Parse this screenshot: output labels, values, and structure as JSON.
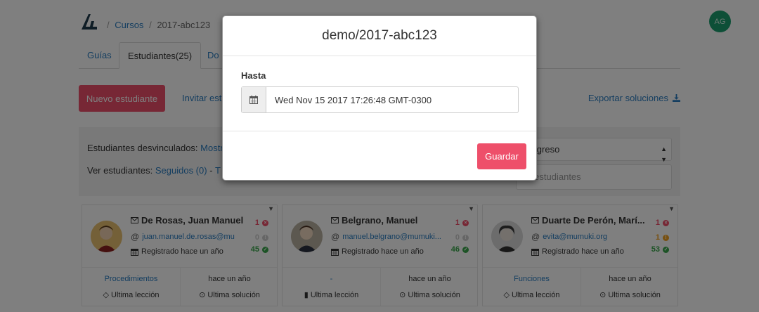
{
  "app": {
    "avatar_initials": "AG",
    "brand_color": "#ee4f6a",
    "link_color": "#2a7dc1"
  },
  "breadcrumb": {
    "cursos": "Cursos",
    "current": "2017-abc123"
  },
  "tabs": [
    {
      "label": "Guías"
    },
    {
      "label": "Estudiantes(25)"
    },
    {
      "label": "Do"
    }
  ],
  "actions": {
    "nuevo": "Nuevo estudiante",
    "invitar": "Invitar est",
    "exportar": "Exportar soluciones"
  },
  "filters": {
    "desvinculados_label": "Estudiantes desvinculados:",
    "desvinculados_link": "Mostr",
    "ver_label": "Ver estudiantes:",
    "seguidos": "Seguidos (0)",
    "dash": "-",
    "todos": "T",
    "orden_selected": "progreso",
    "search_placeholder": "ar estudiantes"
  },
  "students": [
    {
      "name": "De Rosas, Juan Manuel",
      "email": "juan.manuel.de.rosas@mu",
      "registered": "Registrado hace un año",
      "stats": {
        "failed": "1",
        "pending": "0",
        "passed": "45"
      },
      "pending_color": "#ccc",
      "last_lesson_value": "Procedimientos",
      "last_solution_value": "hace un año",
      "last_lesson_label": "Ultima lección",
      "last_solution_label": "Ultima solución"
    },
    {
      "name": "Belgrano, Manuel",
      "email": "manuel.belgrano@mumuki...",
      "registered": "Registrado hace un año",
      "stats": {
        "failed": "1",
        "pending": "0",
        "passed": "46"
      },
      "pending_color": "#ccc",
      "last_lesson_value": "-",
      "last_solution_value": "hace un año",
      "last_lesson_label": "Ultima lección",
      "last_solution_label": "Ultima solución"
    },
    {
      "name": "Duarte De Perón, Marí...",
      "email": "evita@mumuki.org",
      "registered": "Registrado hace un año",
      "stats": {
        "failed": "1",
        "pending": "1",
        "passed": "53"
      },
      "pending_color": "#f0a020",
      "last_lesson_value": "Funciones",
      "last_solution_value": "hace un año",
      "last_lesson_label": "Ultima lección",
      "last_solution_label": "Ultima solución"
    }
  ],
  "modal": {
    "title": "demo/2017-abc123",
    "hasta_label": "Hasta",
    "date_value": "Wed Nov 15 2017 17:26:48 GMT-0300",
    "save": "Guardar"
  }
}
